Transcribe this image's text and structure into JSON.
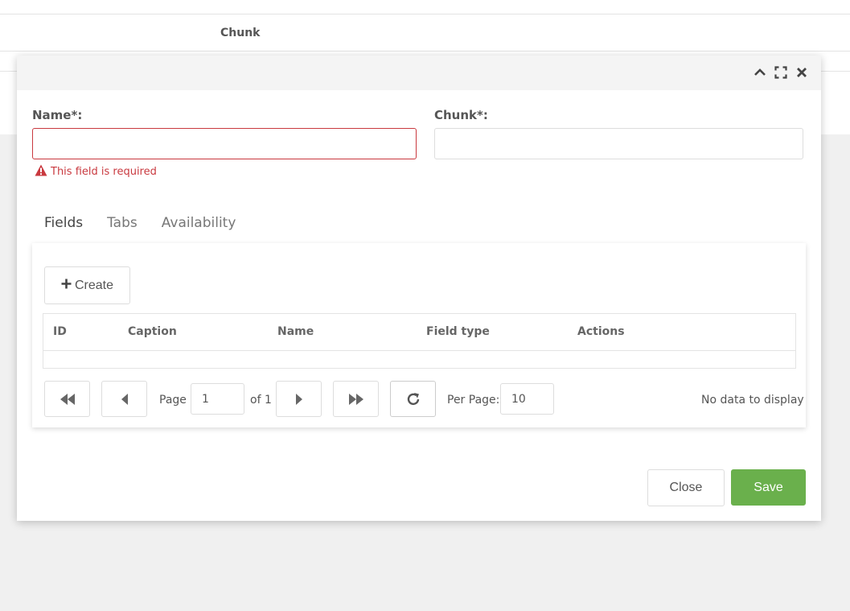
{
  "background": {
    "column_header": "Chunk"
  },
  "form": {
    "name_label": "Name*:",
    "name_value": "",
    "name_error": "This field is required",
    "chunk_label": "Chunk*:",
    "chunk_value": ""
  },
  "tabs": [
    {
      "label": "Fields",
      "active": true
    },
    {
      "label": "Tabs",
      "active": false
    },
    {
      "label": "Availability",
      "active": false
    }
  ],
  "grid": {
    "create_label": "Create",
    "columns": [
      "ID",
      "Caption",
      "Name",
      "Field type",
      "Actions"
    ],
    "rows": []
  },
  "pagination": {
    "page_label": "Page",
    "page_value": "1",
    "of_label": "of 1",
    "per_page_label": "Per Page:",
    "per_page_value": "10",
    "status": "No data to display"
  },
  "footer": {
    "close_label": "Close",
    "save_label": "Save"
  },
  "colors": {
    "accent": "#6ab04c",
    "error": "#c9393f"
  }
}
